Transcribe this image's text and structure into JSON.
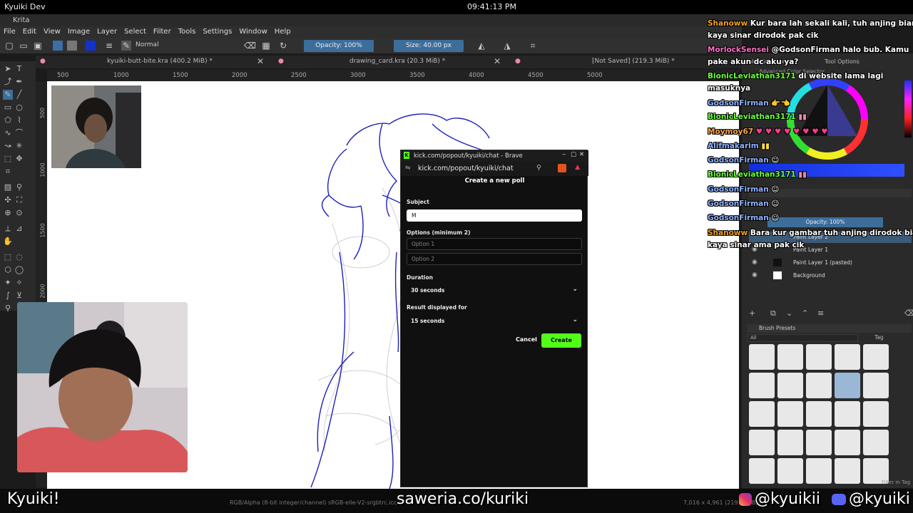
{
  "system": {
    "app_name": "Kyuiki Dev",
    "clock": "09:41:13 PM"
  },
  "window": {
    "title": "Krita"
  },
  "menu": [
    "File",
    "Edit",
    "View",
    "Image",
    "Layer",
    "Select",
    "Filter",
    "Tools",
    "Settings",
    "Window",
    "Help"
  ],
  "toolbar": {
    "blend_mode": "Normal",
    "opacity": "Opacity: 100%",
    "size": "Size: 40.00 px"
  },
  "tabs": [
    {
      "label": "kyuiki-butt-bite.kra (400.2 MiB) *"
    },
    {
      "label": "drawing_card.kra (20.3 MiB) *"
    },
    {
      "label": "[Not Saved]  (219.3 MiB) *"
    }
  ],
  "ruler_ticks": [
    "500",
    "1000",
    "1500",
    "2000",
    "2500",
    "3000",
    "3500",
    "4000",
    "4500",
    "5000"
  ],
  "vruler_ticks": [
    "500",
    "1000",
    "1500",
    "2000"
  ],
  "browser": {
    "window_title": "kick.com/popout/kyuiki/chat - Brave",
    "url": "kick.com/popout/kyuiki/chat"
  },
  "poll": {
    "heading": "Create a new poll",
    "subject_label": "Subject",
    "subject_value": "M",
    "options_label": "Options (minimum 2)",
    "option1_placeholder": "Option 1",
    "option2_placeholder": "Option 2",
    "duration_label": "Duration",
    "duration_value": "30 seconds",
    "result_label": "Result displayed for",
    "result_value": "15 seconds",
    "cancel": "Cancel",
    "create": "Create"
  },
  "chat": [
    {
      "user": "Shanoww",
      "user_color": "#f0a020",
      "text": "Kur bara lah sekali kali, tuh anjing biar"
    },
    {
      "user": "",
      "user_color": "#ffffff",
      "text": "kaya sinar dirodok pak cik"
    },
    {
      "user": "MorlockSensei",
      "user_color": "#ff6ec7",
      "text": "@GodsonFirman halo bub. Kamu"
    },
    {
      "user": "",
      "user_color": "#ffffff",
      "text": "pake akun dc aku ya?"
    },
    {
      "user": "BionicLeviathan3171",
      "user_color": "#6cff3a",
      "text": "di website lama lagi"
    },
    {
      "user": "",
      "user_color": "#ffffff",
      "text": "masuknya"
    },
    {
      "user": "GodsonFirman",
      "user_color": "#8fb4ff",
      "text": "👉👈"
    },
    {
      "user": "BionicLeviathan3171",
      "user_color": "#6cff3a",
      "text": ""
    },
    {
      "user": "Moymoy67",
      "user_color": "#f7a64a",
      "text": ""
    },
    {
      "user": "Alifmakarim",
      "user_color": "#8fb4ff",
      "text": ""
    },
    {
      "user": "GodsonFirman",
      "user_color": "#8fb4ff",
      "text": ""
    },
    {
      "user": "BionicLeviathan3171",
      "user_color": "#6cff3a",
      "text": ""
    },
    {
      "user": "GodsonFirman",
      "user_color": "#8fb4ff",
      "text": ""
    },
    {
      "user": "GodsonFirman",
      "user_color": "#8fb4ff",
      "text": ""
    },
    {
      "user": "GodsonFirman",
      "user_color": "#8fb4ff",
      "text": ""
    },
    {
      "user": "Shanoww",
      "user_color": "#f0a020",
      "text": "Bara kur gambar tuh anjing dirodok biar"
    },
    {
      "user": "",
      "user_color": "#ffffff",
      "text": "kaya sinar ama pak cik"
    }
  ],
  "dock": {
    "color_selector_tab": "Color Selector",
    "tool_options_tab": "Tool Options",
    "advanced_color_selector": "Advanced Color Selector",
    "layers_opacity": "Opacity: 100%",
    "layers": [
      "Paint Layer 2",
      "Paint Layer 1",
      "Paint Layer 1 (pasted)",
      "Background"
    ],
    "brush_presets_title": "Brush Presets",
    "brush_filter": "All",
    "brush_tag": "Tag",
    "filter_in_tag": "Filter in Tag"
  },
  "status": {
    "color_info": "RGB/Alpha (8-bit integer/channel)  sRGB-elle-V2-srgbtrc.icc",
    "dimensions": "7,016 x 4,961 (219.3 MiB)"
  },
  "overlay": {
    "left": "Kyuiki!",
    "center": "saweria.co/kuriki",
    "instagram": "@kyuikii",
    "discord": "@kyuiki"
  },
  "colors": {
    "kick_green": "#53fc18",
    "krita_blue": "#3d6e9a"
  }
}
